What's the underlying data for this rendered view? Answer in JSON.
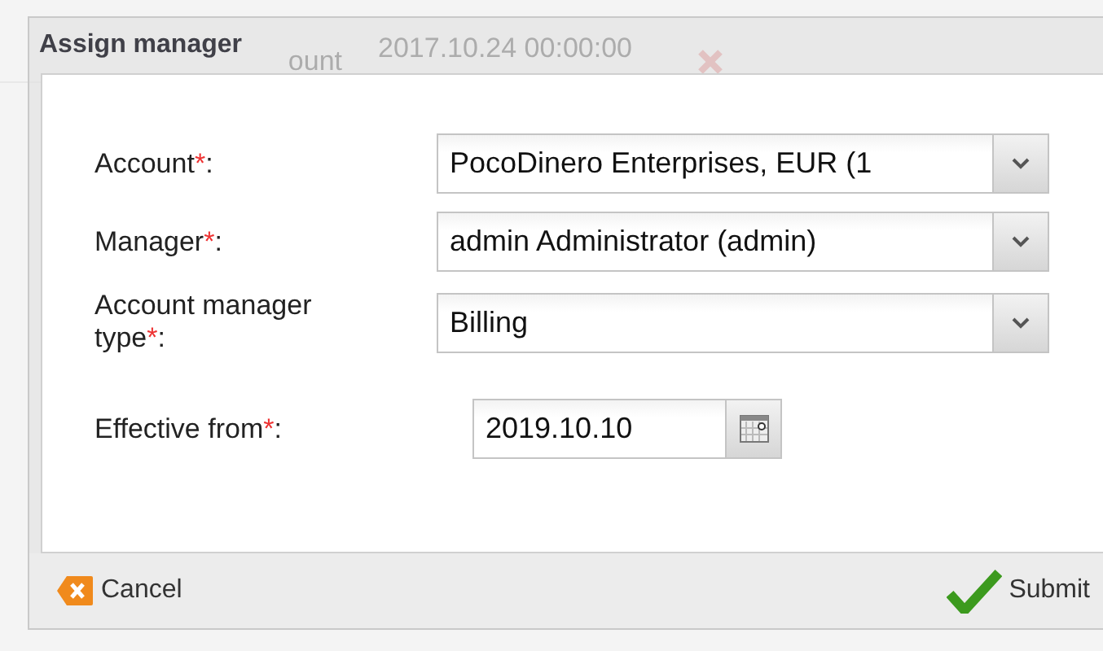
{
  "background": {
    "rows": [
      {
        "label": "ount",
        "date": "2017.10.24 00:00:00"
      }
    ]
  },
  "dialog": {
    "title": "Assign manager",
    "fields": [
      {
        "kind": "select",
        "label": "Account",
        "required_mark": "*",
        "suffix": ":",
        "value": "PocoDinero Enterprises, EUR (1"
      },
      {
        "kind": "select",
        "label": "Manager",
        "required_mark": "*",
        "suffix": ":",
        "value": "admin Administrator (admin)"
      },
      {
        "kind": "select",
        "label": "Account manager type",
        "required_mark": "*",
        "suffix": ":",
        "value": "Billing"
      },
      {
        "kind": "date",
        "label": "Effective from",
        "required_mark": "*",
        "suffix": ":",
        "value": "2019.10.10"
      }
    ],
    "buttons": [
      {
        "kind": "cancel",
        "label": "Cancel"
      },
      {
        "kind": "submit",
        "label": "Submit"
      }
    ]
  }
}
